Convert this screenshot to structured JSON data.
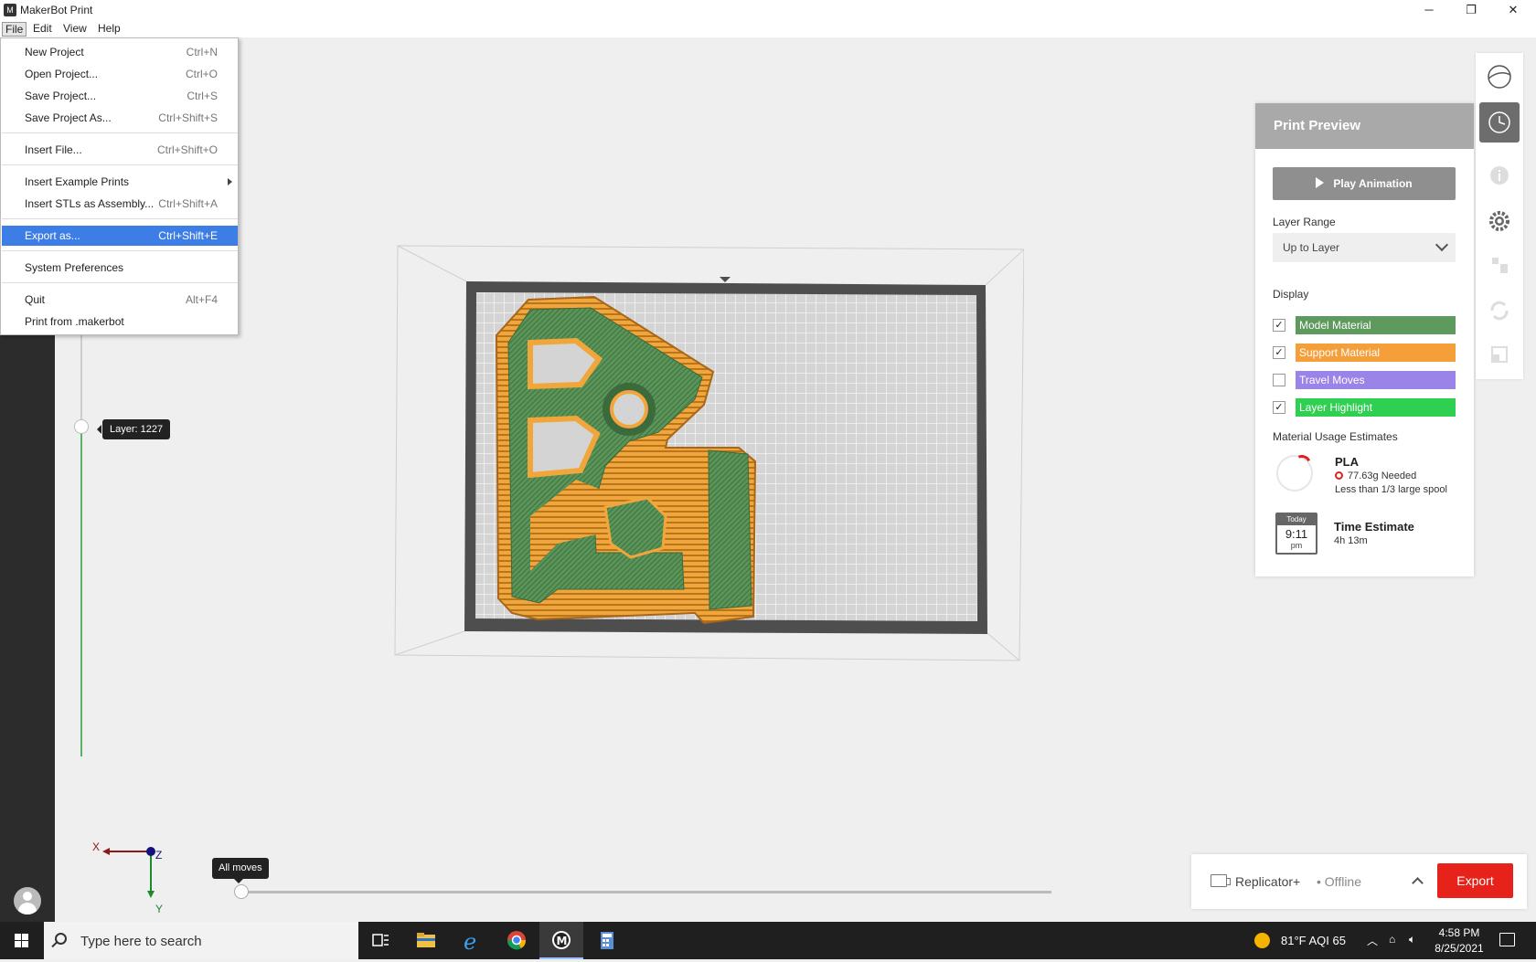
{
  "window": {
    "title": "MakerBot Print",
    "app_icon": "makerbot-m-icon",
    "controls": {
      "minimize": "─",
      "restore": "❐",
      "close": "✕"
    }
  },
  "menubar": {
    "file": "File",
    "edit": "Edit",
    "view": "View",
    "help": "Help"
  },
  "file_menu": {
    "items": [
      {
        "label": "New Project",
        "shortcut": "Ctrl+N"
      },
      {
        "label": "Open Project...",
        "shortcut": "Ctrl+O"
      },
      {
        "label": "Save Project...",
        "shortcut": "Ctrl+S"
      },
      {
        "label": "Save Project As...",
        "shortcut": "Ctrl+Shift+S"
      },
      {
        "label": "Insert File...",
        "shortcut": "Ctrl+Shift+O"
      },
      {
        "label": "Insert Example Prints",
        "shortcut": ""
      },
      {
        "label": "Insert STLs as Assembly...",
        "shortcut": "Ctrl+Shift+A"
      },
      {
        "label": "Export as...",
        "shortcut": "Ctrl+Shift+E"
      },
      {
        "label": "System Preferences",
        "shortcut": ""
      },
      {
        "label": "Quit",
        "shortcut": "Alt+F4"
      },
      {
        "label": "Print from .makerbot",
        "shortcut": ""
      }
    ],
    "selected": "Export as..."
  },
  "viewport": {
    "layer_tooltip": "Layer: 1227",
    "moves_tooltip": "All moves",
    "axes": {
      "x": "X",
      "y": "Y",
      "z": "Z"
    }
  },
  "right_toolbar": {
    "icons": [
      "view-sphere-icon",
      "print-preview-icon",
      "info-icon",
      "settings-gear-icon",
      "arrange-icon",
      "rotate-icon",
      "scale-icon"
    ]
  },
  "print_preview": {
    "title": "Print Preview",
    "play_button": "Play Animation",
    "layer_range_label": "Layer Range",
    "layer_range_value": "Up to Layer",
    "display_label": "Display",
    "display_options": [
      {
        "label": "Model Material",
        "checked": true,
        "color": "#5e9a5e"
      },
      {
        "label": "Support Material",
        "checked": true,
        "color": "#f59f3b"
      },
      {
        "label": "Travel Moves",
        "checked": false,
        "color": "#9b84e8"
      },
      {
        "label": "Layer Highlight",
        "checked": true,
        "color": "#2fcf52"
      }
    ],
    "material_label": "Material Usage Estimates",
    "material": {
      "name": "PLA",
      "needed": "77.63g  Needed",
      "spool": "Less than 1/3 large spool"
    },
    "time_label": "Time Estimate",
    "time_value": "4h 13m",
    "calendar": {
      "day": "Today",
      "time": "9:11",
      "ampm": "pm"
    }
  },
  "export_bar": {
    "printer": "Replicator+",
    "status": "• Offline",
    "button": "Export"
  },
  "taskbar": {
    "search_placeholder": "Type here to search",
    "weather": "81°F  AQI 65",
    "time": "4:58 PM",
    "date": "8/25/2021"
  },
  "colors": {
    "model": "#5e9a5e",
    "support": "#f59f3b",
    "export": "#e6221b",
    "menu_highlight": "#3d7ee6",
    "layer_track": "#58b36a"
  }
}
